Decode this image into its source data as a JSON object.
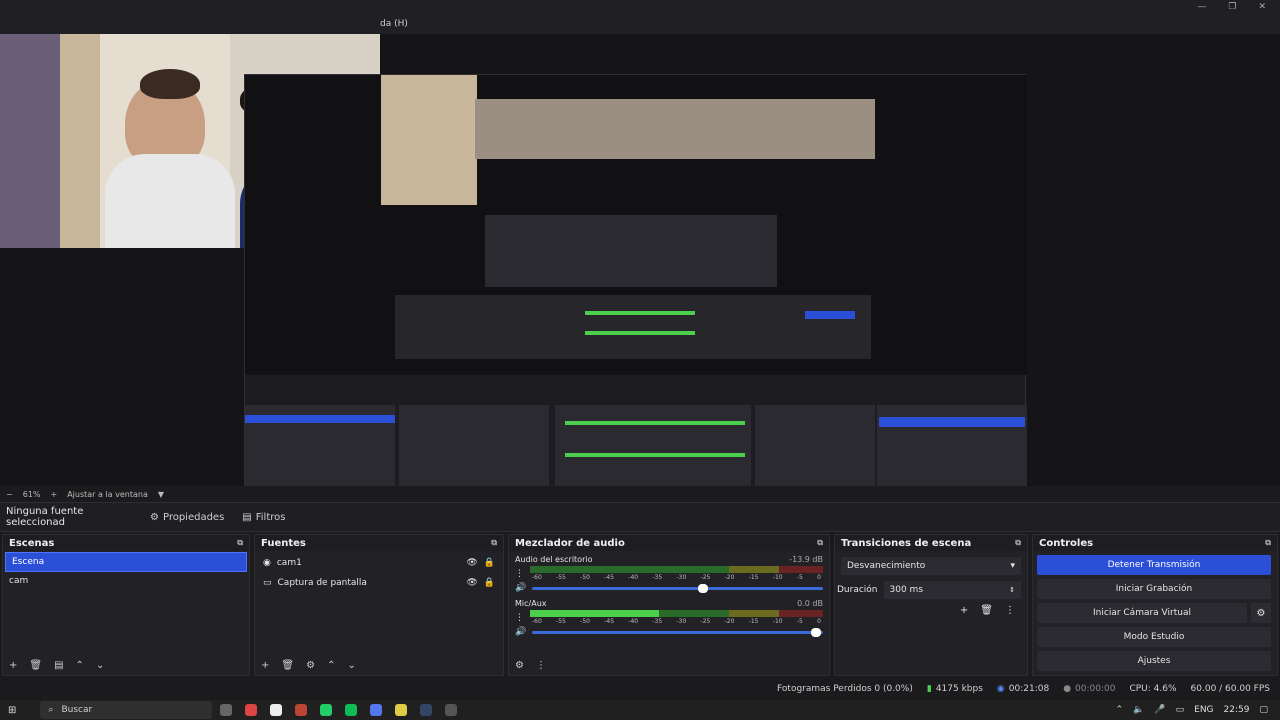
{
  "window": {
    "menu_fragment": "da (H)",
    "controls": [
      "—",
      "❐",
      "✕"
    ]
  },
  "zoom": {
    "label": "61%",
    "fit": "Ajustar a la ventana"
  },
  "props_bar": {
    "no_source": "Ninguna fuente seleccionad",
    "properties": "Propiedades",
    "filters": "Filtros"
  },
  "scenes": {
    "title": "Escenas",
    "items": [
      "Escena",
      "cam"
    ],
    "selected": 0
  },
  "sources": {
    "title": "Fuentes",
    "items": [
      "cam1",
      "Captura de pantalla"
    ]
  },
  "mixer": {
    "title": "Mezclador de audio",
    "channels": [
      {
        "name": "Audio del escritorio",
        "db": "-13.9 dB",
        "level": 0.0
      },
      {
        "name": "Mic/Aux",
        "db": "0.0 dB",
        "level": 0.44
      }
    ],
    "ticks": [
      "-60",
      "-55",
      "-50",
      "-45",
      "-40",
      "-35",
      "-30",
      "-25",
      "-20",
      "-15",
      "-10",
      "-5",
      "0"
    ]
  },
  "transitions": {
    "title": "Transiciones de escena",
    "selected": "Desvanecimiento",
    "duration_label": "Duración",
    "duration_value": "300 ms"
  },
  "controls": {
    "title": "Controles",
    "buttons": [
      "Detener Transmisión",
      "Iniciar Grabación",
      "Iniciar Cámara Virtual",
      "Modo Estudio",
      "Ajustes"
    ]
  },
  "status": {
    "dropped": "Fotogramas Perdidos 0 (0.0%)",
    "bitrate": "4175 kbps",
    "stream_time": "00:21:08",
    "rec_time": "00:00:00",
    "cpu": "CPU: 4.6%",
    "fps": "60.00 / 60.00 FPS"
  },
  "taskbar": {
    "search": "Buscar",
    "lang": "ENG",
    "time": "22:59"
  },
  "colors": {
    "accent": "#2c4fd8",
    "meter_green": "#4cd04c",
    "meter_yellow": "#b5a52a",
    "meter_red": "#b52a2a"
  }
}
